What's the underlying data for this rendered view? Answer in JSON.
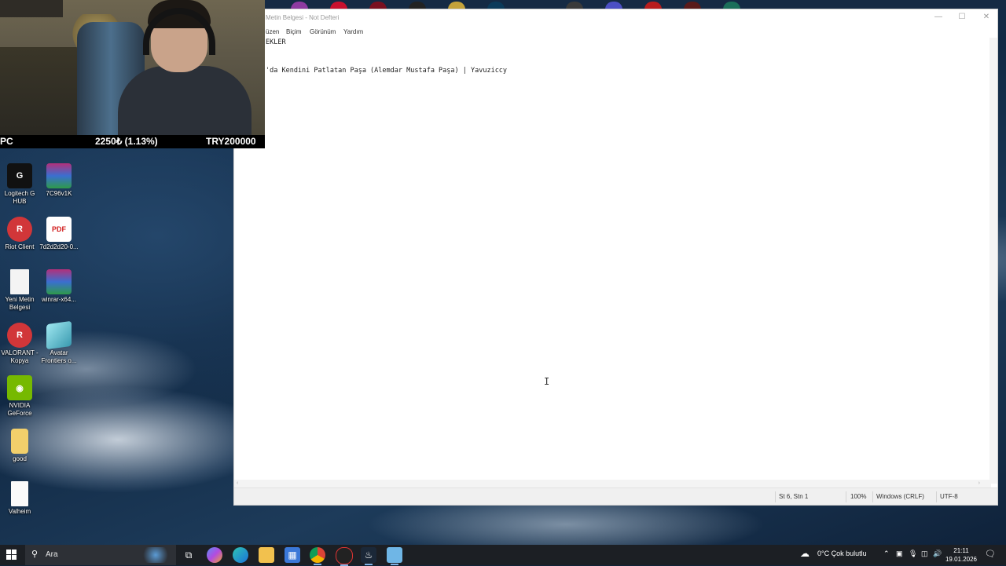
{
  "colors": {
    "taskbar": "#1c1f24",
    "notepad_bg": "#ffffff",
    "status_bg": "#f0f0f0",
    "accent": "#7fb2e5"
  },
  "notepad": {
    "title": "Metin Belgesi - Not Defteri",
    "menu": [
      "üzen",
      "Biçim",
      "Görünüm",
      "Yardım"
    ],
    "lines": [
      "EKLER",
      "",
      "",
      "'da Kendini Patlatan Paşa (Alemdar Mustafa Paşa) | Yavuziccy"
    ],
    "status": {
      "position": "St 6, Stn 1",
      "zoom": "100%",
      "line_ending": "Windows (CRLF)",
      "encoding": "UTF-8"
    },
    "controls": {
      "minimize": "—",
      "maximize": "☐",
      "close": "✕"
    }
  },
  "stream_overlay": {
    "left": "PC",
    "center": "2250₺ (1.13%)",
    "right": "TRY200000"
  },
  "desktop_icons": [
    {
      "label": "Logitech G HUB",
      "icon": "logitech-g-hub-icon"
    },
    {
      "label": "7C96v1K",
      "icon": "winrar-archive-icon"
    },
    {
      "label": "Riot Client",
      "icon": "riot-client-icon"
    },
    {
      "label": "7d2d2d20-0...",
      "icon": "pdf-file-icon"
    },
    {
      "label": "Yeni Metin Belgesi",
      "icon": "text-document-icon"
    },
    {
      "label": "winrar-x64...",
      "icon": "winrar-installer-icon"
    },
    {
      "label": "VALORANT - Kopya",
      "icon": "valorant-icon"
    },
    {
      "label": "Avatar Frontiers o...",
      "icon": "avatar-game-icon"
    },
    {
      "label": "NVIDIA GeForce",
      "icon": "nvidia-icon"
    },
    {
      "label": "good",
      "icon": "folder-icon"
    },
    {
      "label": "Valheim",
      "icon": "valheim-file-icon"
    }
  ],
  "taskbar": {
    "search_placeholder": "Ara",
    "weather": "0°C  Çok bulutlu",
    "time": "21:11",
    "date": "19.01.2026"
  }
}
